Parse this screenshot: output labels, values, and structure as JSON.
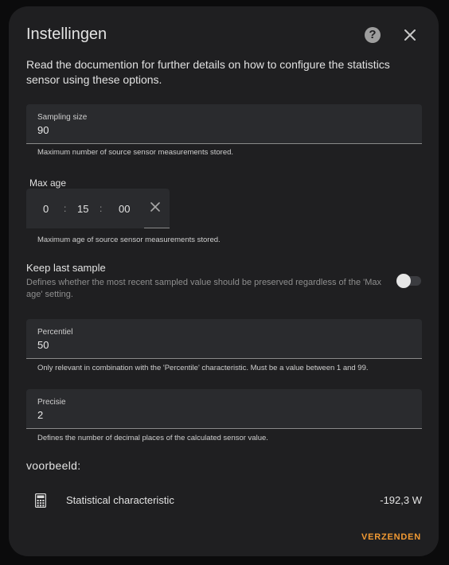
{
  "dialog": {
    "title": "Instellingen",
    "description": "Read the documention for further details on how to configure the statistics sensor using these options."
  },
  "sampling_size": {
    "label": "Sampling size",
    "value": "90",
    "helper": "Maximum number of source sensor measurements stored."
  },
  "max_age": {
    "label": "Max age",
    "hours": "0",
    "minutes": "15",
    "seconds": "00",
    "separator": ":",
    "helper": "Maximum age of source sensor measurements stored."
  },
  "keep_last_sample": {
    "title": "Keep last sample",
    "description": "Defines whether the most recent sampled value should be preserved regardless of the 'Max age' setting.",
    "enabled": false
  },
  "percentile": {
    "label": "Percentiel",
    "value": "50",
    "helper": "Only relevant in combination with the 'Percentile' characteristic. Must be a value between 1 and 99."
  },
  "precision": {
    "label": "Precisie",
    "value": "2",
    "helper": "Defines the number of decimal places of the calculated sensor value."
  },
  "preview": {
    "title": "voorbeeld:",
    "entity_name": "Statistical characteristic",
    "entity_value": "-192,3 W",
    "icon": "calculator-icon"
  },
  "actions": {
    "submit_label": "VERZENDEN"
  },
  "colors": {
    "accent": "#f29a33",
    "dialog_bg": "#1f1f21",
    "field_bg": "#2a2b2e"
  }
}
